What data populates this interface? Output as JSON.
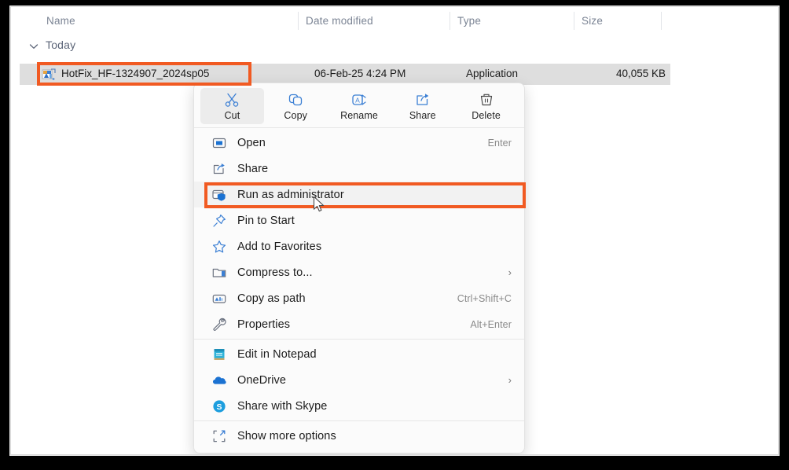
{
  "columns": [
    {
      "label": "Name"
    },
    {
      "label": "Date modified"
    },
    {
      "label": "Type"
    },
    {
      "label": "Size"
    }
  ],
  "group": {
    "label": "Today",
    "chevron_icon": "chevron-down-icon"
  },
  "file_row": {
    "icon": "application-file-icon",
    "name": "HotFix_HF-1324907_2024sp05",
    "date_modified": "06-Feb-25 4:24 PM",
    "type": "Application",
    "size": "40,055 KB",
    "selected": true
  },
  "context_menu": {
    "toolbar": [
      {
        "label": "Cut",
        "icon": "scissors-icon",
        "active": true
      },
      {
        "label": "Copy",
        "icon": "copy-icon",
        "active": false
      },
      {
        "label": "Rename",
        "icon": "rename-icon",
        "active": false
      },
      {
        "label": "Share",
        "icon": "share-icon",
        "active": false
      },
      {
        "label": "Delete",
        "icon": "trash-icon",
        "active": false
      }
    ],
    "items": [
      {
        "label": "Open",
        "icon": "open-icon",
        "accel": "Enter",
        "arrow": "",
        "highlight": false
      },
      {
        "label": "Share",
        "icon": "share-icon",
        "accel": "",
        "arrow": "",
        "highlight": false
      },
      {
        "label": "Run as administrator",
        "icon": "shield-run-icon",
        "accel": "",
        "arrow": "",
        "highlight": true
      },
      {
        "label": "Pin to Start",
        "icon": "pin-icon",
        "accel": "",
        "arrow": "",
        "highlight": false
      },
      {
        "label": "Add to Favorites",
        "icon": "star-icon",
        "accel": "",
        "arrow": "",
        "highlight": false
      },
      {
        "label": "Compress to...",
        "icon": "compress-icon",
        "accel": "",
        "arrow": "›",
        "highlight": false
      },
      {
        "label": "Copy as path",
        "icon": "copy-path-icon",
        "accel": "Ctrl+Shift+C",
        "arrow": "",
        "highlight": false
      },
      {
        "label": "Properties",
        "icon": "wrench-icon",
        "accel": "Alt+Enter",
        "arrow": "",
        "highlight": false
      },
      {
        "label": "Edit in Notepad",
        "icon": "notepad-icon",
        "accel": "",
        "arrow": "",
        "highlight": false
      },
      {
        "label": "OneDrive",
        "icon": "onedrive-icon",
        "accel": "",
        "arrow": "›",
        "highlight": false
      },
      {
        "label": "Share with Skype",
        "icon": "skype-icon",
        "accel": "",
        "arrow": "",
        "highlight": false
      },
      {
        "label": "Show more options",
        "icon": "more-options-icon",
        "accel": "",
        "arrow": "",
        "highlight": false
      }
    ]
  },
  "annotations": [
    {
      "name": "file-name-highlight",
      "color": "#f15a22"
    },
    {
      "name": "run-as-administrator-highlight",
      "color": "#f15a22"
    }
  ],
  "cursor": {
    "icon": "mouse-pointer-icon"
  }
}
